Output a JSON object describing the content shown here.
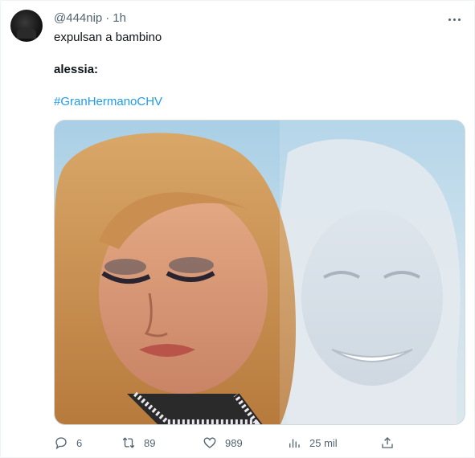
{
  "tweet": {
    "handle": "@444nip",
    "separator": "·",
    "time": "1h",
    "text_line1": "expulsan a bambino",
    "text_line2": "alessia:",
    "hashtag": "#GranHermanoCHV"
  },
  "actions": {
    "replies": "6",
    "retweets": "89",
    "likes": "989",
    "views": "25 mil"
  },
  "colors": {
    "accent": "#1d9bf0",
    "muted": "#536471",
    "text": "#0f1419"
  },
  "icons": [
    "more-icon",
    "reply-icon",
    "retweet-icon",
    "like-icon",
    "views-icon",
    "share-icon"
  ]
}
